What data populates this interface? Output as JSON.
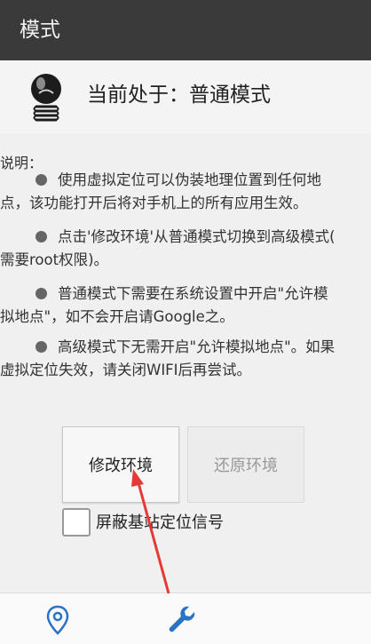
{
  "app": {
    "title": "模式"
  },
  "status": {
    "text": "当前处于：普通模式",
    "icon": "lightbulb-icon"
  },
  "description": {
    "label": "说明：",
    "items": [
      {
        "line1": "使用虚拟定位可以伪装地理位置到任何地",
        "line2": "点，该功能打开后将对手机上的所有应用生效。"
      },
      {
        "line1": "点击'修改环境'从普通模式切换到高级模式(",
        "line2": "需要root权限)。"
      },
      {
        "line1": "普通模式下需要在系统设置中开启\"允许模",
        "line2": "拟地点\"，如不会开启请Google之。"
      },
      {
        "line1": "高级模式下无需开启\"允许模拟地点\"。如果",
        "line2": "虚拟定位失效，请关闭WIFI后再尝试。"
      }
    ]
  },
  "buttons": {
    "modify": "修改环境",
    "restore": "还原环境"
  },
  "checkbox": {
    "label": "屏蔽基站定位信号",
    "checked": false
  },
  "bottom_nav": {
    "items": [
      {
        "icon": "location-pin-icon",
        "active": false
      },
      {
        "icon": "wrench-icon",
        "active": true
      }
    ]
  },
  "colors": {
    "titlebar": "#3a3a3a",
    "accent": "#2a73c4",
    "annotation_arrow": "#e53935"
  }
}
